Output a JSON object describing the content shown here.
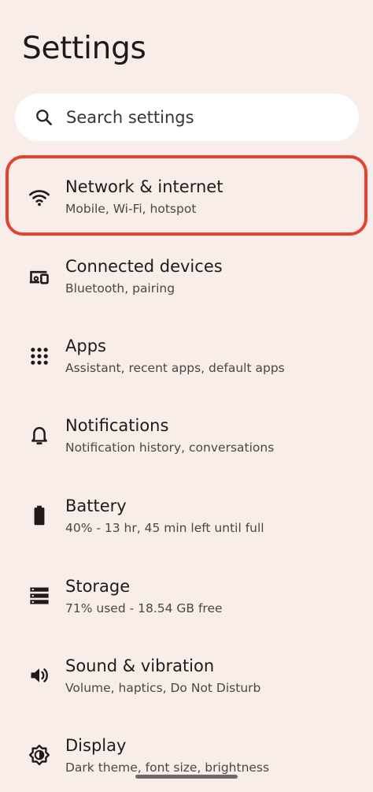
{
  "header": {
    "title": "Settings"
  },
  "search": {
    "placeholder": "Search settings",
    "icon": "search-icon"
  },
  "highlight": {
    "color": "#e5422d",
    "target": "Network & internet"
  },
  "items": [
    {
      "title": "Network & internet",
      "subtitle": "Mobile, Wi-Fi, hotspot",
      "icon": "wifi-icon"
    },
    {
      "title": "Connected devices",
      "subtitle": "Bluetooth, pairing",
      "icon": "devices-icon"
    },
    {
      "title": "Apps",
      "subtitle": "Assistant, recent apps, default apps",
      "icon": "apps-grid-icon"
    },
    {
      "title": "Notifications",
      "subtitle": "Notification history, conversations",
      "icon": "bell-icon"
    },
    {
      "title": "Battery",
      "subtitle": "40% - 13 hr, 45 min left until full",
      "icon": "battery-icon"
    },
    {
      "title": "Storage",
      "subtitle": "71% used - 18.54 GB free",
      "icon": "storage-icon"
    },
    {
      "title": "Sound & vibration",
      "subtitle": "Volume, haptics, Do Not Disturb",
      "icon": "speaker-icon"
    },
    {
      "title": "Display",
      "subtitle": "Dark theme, font size, brightness",
      "icon": "brightness-icon"
    }
  ],
  "colors": {
    "background": "#f8ede9",
    "search_background": "#ffffff",
    "text_primary": "#1f1a19",
    "text_secondary": "#4d4543"
  }
}
